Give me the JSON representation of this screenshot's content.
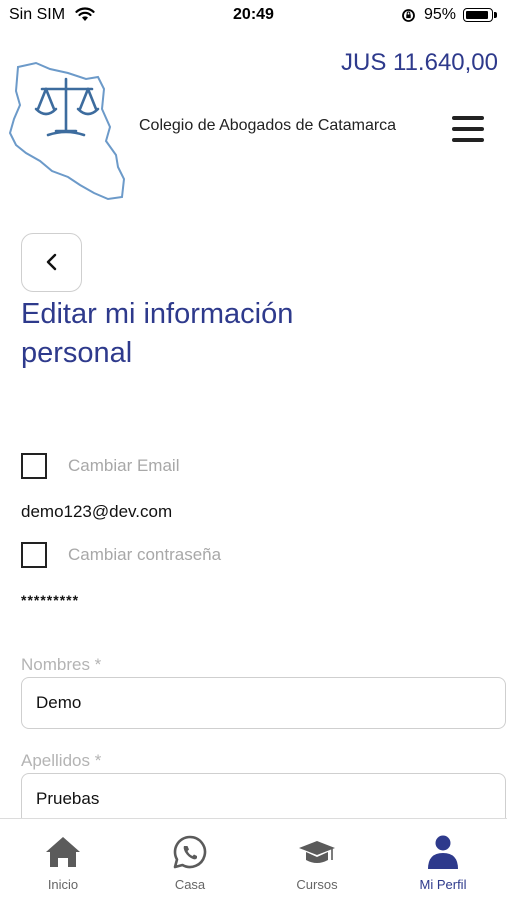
{
  "status_bar": {
    "carrier": "Sin SIM",
    "time": "20:49",
    "battery": "95%",
    "battery_level": 0.95
  },
  "header": {
    "balance": "JUS 11.640,00",
    "organization": "Colegio de Abogados de Catamarca"
  },
  "page": {
    "title": "Editar mi información personal"
  },
  "account": {
    "change_email_label": "Cambiar Email",
    "email": "demo123@dev.com",
    "change_password_label": "Cambiar contraseña",
    "password_mask": "*********"
  },
  "form": {
    "first_name_label": "Nombres *",
    "first_name_value": "Demo",
    "last_name_label": "Apellidos *",
    "last_name_value": "Pruebas"
  },
  "tabs": [
    {
      "label": "Inicio",
      "icon": "home-icon"
    },
    {
      "label": "Casa",
      "icon": "whatsapp-icon"
    },
    {
      "label": "Cursos",
      "icon": "graduation-cap-icon"
    },
    {
      "label": "Mi Perfil",
      "icon": "user-icon"
    }
  ],
  "colors": {
    "accent": "#2e3a8c",
    "muted": "#a8a8a8",
    "border": "#cfcfcf"
  }
}
